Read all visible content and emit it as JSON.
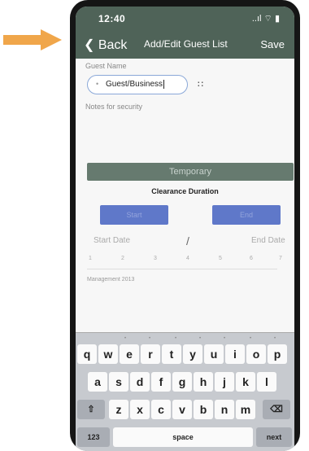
{
  "status_bar": {
    "time": "12:40",
    "icons": "..ıl ⌔ ▮"
  },
  "nav": {
    "back_label": "Back",
    "title": "Add/Edit Guest List",
    "save_label": "Save"
  },
  "form": {
    "guest_name_label": "Guest Name",
    "guest_name_value": "Guest/Business",
    "notes_label": "Notes for security",
    "temporary_label": "Temporary",
    "clearance_duration_label": "Clearance Duration",
    "start_button_label": "Start",
    "end_button_label": "End",
    "start_date_label": "Start Date",
    "end_date_label": "End Date",
    "date_sub_text": "Management 2013"
  },
  "keyboard": {
    "row1": [
      "q",
      "w",
      "e",
      "r",
      "t",
      "y",
      "u",
      "i",
      "o",
      "p"
    ],
    "row2": [
      "a",
      "s",
      "d",
      "f",
      "g",
      "h",
      "j",
      "k",
      "l"
    ],
    "row3": [
      "z",
      "x",
      "c",
      "v",
      "b",
      "n",
      "m"
    ],
    "num_label": "123",
    "space_label": "space",
    "next_label": "next"
  },
  "colors": {
    "nav_bar": "#4f6358",
    "temporary_button": "#667a6f",
    "blue_button": "#5f78c9",
    "arrow": "#f0a64a"
  }
}
